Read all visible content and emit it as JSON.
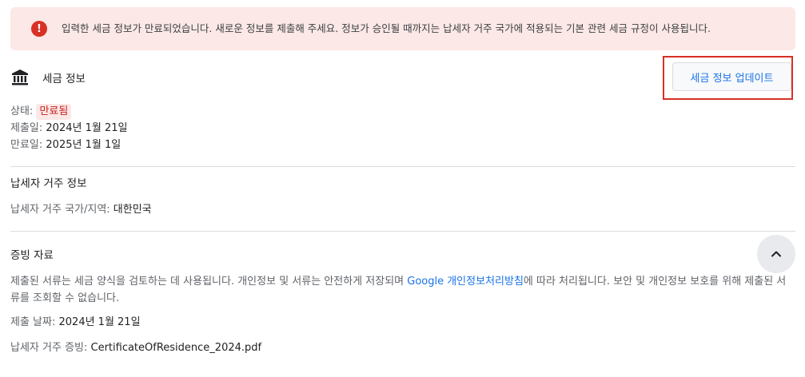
{
  "alert": {
    "icon": "error-icon",
    "icon_glyph": "!",
    "message": "입력한 세금 정보가 만료되었습니다. 새로운 정보를 제출해 주세요. 정보가 승인될 때까지는 납세자 거주 국가에 적용되는 기본 관련 세금 규정이 사용됩니다."
  },
  "tax_info": {
    "icon": "bank-icon",
    "title": "세금 정보",
    "update_button": "세금 정보 업데이트",
    "status_label": "상태: ",
    "status_value": "만료됨",
    "submitted_label": "제출일: ",
    "submitted_value": "2024년 1월 21일",
    "expires_label": "만료일: ",
    "expires_value": "2025년 1월 1일"
  },
  "residence": {
    "title": "납세자 거주 정보",
    "country_label": "납세자 거주 국가/지역: ",
    "country_value": "대한민국"
  },
  "documents": {
    "title": "증빙 자료",
    "description_before": "제출된 서류는 세금 양식을 검토하는 데 사용됩니다. 개인정보 및 서류는 안전하게 저장되며 ",
    "policy_link": "Google 개인정보처리방침",
    "description_after": "에 따라 처리됩니다. 보안 및 개인정보 보호를 위해 제출된 서류를 조회할 수 없습니다.",
    "submitted_label": "제출 날짜: ",
    "submitted_value": "2024년 1월 21일",
    "proof_label": "납세자 거주 증빙: ",
    "proof_value": "CertificateOfResidence_2024.pdf"
  },
  "scroll_top": {
    "icon": "chevron-up-icon"
  },
  "colors": {
    "alert_bg": "#fce8e6",
    "alert_icon": "#d93025",
    "link": "#1a73e8",
    "badge_text": "#c5221f"
  }
}
